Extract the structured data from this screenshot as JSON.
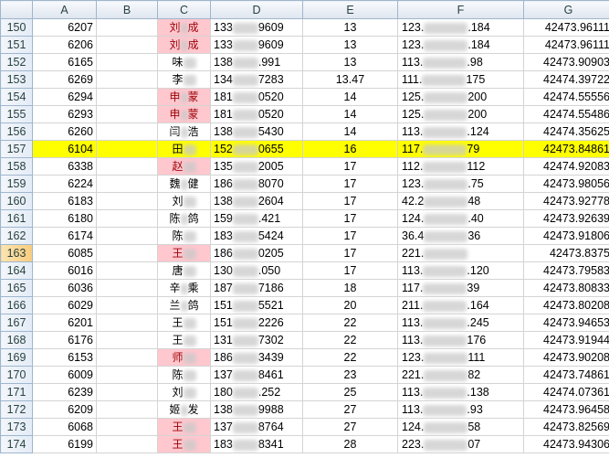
{
  "columns": [
    "A",
    "B",
    "C",
    "D",
    "E",
    "F",
    "G"
  ],
  "rows": [
    {
      "n": "150",
      "a": "6207",
      "c1": "刘",
      "c2": "成",
      "pink": true,
      "d1": "133",
      "d2": "9609",
      "e": "13",
      "f1": "123.",
      "f2": ".184",
      "g": "42473.96111"
    },
    {
      "n": "151",
      "a": "6206",
      "c1": "刘",
      "c2": "成",
      "pink": true,
      "d1": "133",
      "d2": "9609",
      "e": "13",
      "f1": "123.",
      "f2": ".184",
      "g": "42473.96111"
    },
    {
      "n": "152",
      "a": "6165",
      "c1": "味",
      "c2": "",
      "pink": false,
      "d1": "138",
      "d2": ".991",
      "e": "13",
      "f1": "113.",
      "f2": ".98",
      "g": "42473.90903"
    },
    {
      "n": "153",
      "a": "6269",
      "c1": "李",
      "c2": "",
      "pink": false,
      "d1": "134",
      "d2": "7283",
      "e": "13.47",
      "f1": "111.",
      "f2": "175",
      "g": "42474.39722"
    },
    {
      "n": "154",
      "a": "6294",
      "c1": "申",
      "c2": "蒙",
      "pink": true,
      "d1": "181",
      "d2": "0520",
      "e": "14",
      "f1": "125.",
      "f2": "200",
      "g": "42474.55556"
    },
    {
      "n": "155",
      "a": "6293",
      "c1": "申",
      "c2": "蒙",
      "pink": true,
      "d1": "181",
      "d2": "0520",
      "e": "14",
      "f1": "125.",
      "f2": "200",
      "g": "42474.55486"
    },
    {
      "n": "156",
      "a": "6260",
      "c1": "闫",
      "c2": "浩",
      "pink": false,
      "d1": "138",
      "d2": "5430",
      "e": "14",
      "f1": "113.",
      "f2": ".124",
      "g": "42474.35625"
    },
    {
      "n": "157",
      "a": "6104",
      "c1": "田",
      "c2": "",
      "pink": false,
      "d1": "152",
      "d2": "0655",
      "e": "16",
      "f1": "117.",
      "f2": "79",
      "g": "42473.84861",
      "highlight": true
    },
    {
      "n": "158",
      "a": "6338",
      "c1": "赵",
      "c2": "",
      "pink": true,
      "d1": "135",
      "d2": "2005",
      "e": "17",
      "f1": "112.",
      "f2": "112",
      "g": "42474.92083"
    },
    {
      "n": "159",
      "a": "6224",
      "c1": "魏",
      "c2": "健",
      "pink": false,
      "d1": "186",
      "d2": "8070",
      "e": "17",
      "f1": "123.",
      "f2": ".75",
      "g": "42473.98056"
    },
    {
      "n": "160",
      "a": "6183",
      "c1": "刘",
      "c2": "",
      "pink": false,
      "d1": "138",
      "d2": "2604",
      "e": "17",
      "f1": "42.2",
      "f2": "48",
      "g": "42473.92778"
    },
    {
      "n": "161",
      "a": "6180",
      "c1": "陈",
      "c2": "鸽",
      "pink": false,
      "d1": "159",
      "d2": ".421",
      "e": "17",
      "f1": "124.",
      "f2": ".40",
      "g": "42473.92639"
    },
    {
      "n": "162",
      "a": "6174",
      "c1": "陈",
      "c2": "",
      "pink": false,
      "d1": "183",
      "d2": "5424",
      "e": "17",
      "f1": "36.4",
      "f2": "36",
      "g": "42473.91806"
    },
    {
      "n": "163",
      "a": "6085",
      "c1": "王",
      "c2": "",
      "pink": true,
      "d1": "186",
      "d2": "0205",
      "e": "17",
      "f1": "221.",
      "f2": "",
      "g": "42473.8375",
      "active": true
    },
    {
      "n": "164",
      "a": "6016",
      "c1": "唐",
      "c2": "",
      "pink": false,
      "d1": "130",
      "d2": ".050",
      "e": "17",
      "f1": "113.",
      "f2": ".120",
      "g": "42473.79583"
    },
    {
      "n": "165",
      "a": "6036",
      "c1": "辛",
      "c2": "乘",
      "pink": false,
      "d1": "187",
      "d2": "7186",
      "e": "18",
      "f1": "117.",
      "f2": "39",
      "g": "42473.80833"
    },
    {
      "n": "166",
      "a": "6029",
      "c1": "兰",
      "c2": "鸽",
      "pink": false,
      "d1": "151",
      "d2": "5521",
      "e": "20",
      "f1": "211.",
      "f2": ".164",
      "g": "42473.80208"
    },
    {
      "n": "167",
      "a": "6201",
      "c1": "王",
      "c2": "",
      "pink": false,
      "d1": "151",
      "d2": "2226",
      "e": "22",
      "f1": "113.",
      "f2": ".245",
      "g": "42473.94653"
    },
    {
      "n": "168",
      "a": "6176",
      "c1": "王",
      "c2": "",
      "pink": false,
      "d1": "131",
      "d2": "7302",
      "e": "22",
      "f1": "113.",
      "f2": "176",
      "g": "42473.91944"
    },
    {
      "n": "169",
      "a": "6153",
      "c1": "师",
      "c2": "",
      "pink": true,
      "d1": "186",
      "d2": "3439",
      "e": "22",
      "f1": "123.",
      "f2": "111",
      "g": "42473.90208"
    },
    {
      "n": "170",
      "a": "6009",
      "c1": "陈",
      "c2": "",
      "pink": false,
      "d1": "137",
      "d2": "8461",
      "e": "23",
      "f1": "221.",
      "f2": "82",
      "g": "42473.74861"
    },
    {
      "n": "171",
      "a": "6239",
      "c1": "刘",
      "c2": "",
      "pink": false,
      "d1": "180",
      "d2": ".252",
      "e": "25",
      "f1": "113.",
      "f2": ".138",
      "g": "42474.07361"
    },
    {
      "n": "172",
      "a": "6209",
      "c1": "姬",
      "c2": "发",
      "pink": false,
      "d1": "138",
      "d2": "9988",
      "e": "27",
      "f1": "113.",
      "f2": ".93",
      "g": "42473.96458"
    },
    {
      "n": "173",
      "a": "6068",
      "c1": "王",
      "c2": "",
      "pink": true,
      "d1": "137",
      "d2": "8764",
      "e": "27",
      "f1": "124.",
      "f2": "58",
      "g": "42473.82569"
    },
    {
      "n": "174",
      "a": "6199",
      "c1": "王",
      "c2": "",
      "pink": true,
      "d1": "183",
      "d2": "8341",
      "e": "28",
      "f1": "223.",
      "f2": "07",
      "g": "42473.94306"
    }
  ]
}
